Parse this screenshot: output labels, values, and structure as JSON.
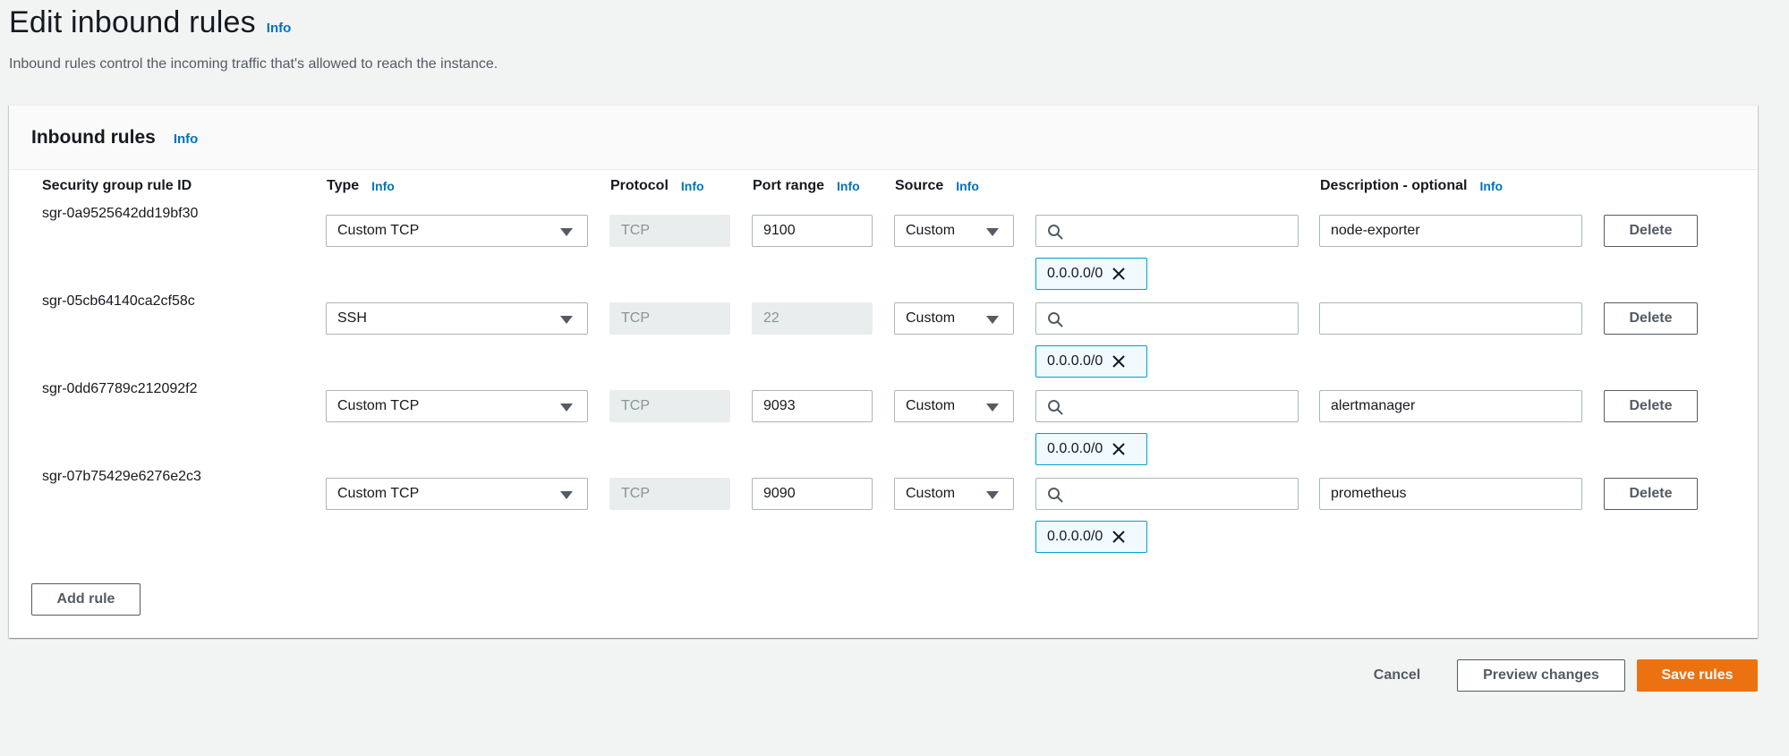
{
  "page": {
    "title": "Edit inbound rules",
    "info": "Info",
    "description": "Inbound rules control the incoming traffic that's allowed to reach the instance."
  },
  "panel": {
    "title": "Inbound rules",
    "info": "Info"
  },
  "columns": {
    "rule_id": "Security group rule ID",
    "type": "Type",
    "protocol": "Protocol",
    "port_range": "Port range",
    "source": "Source",
    "description": "Description - optional",
    "info": "Info"
  },
  "rules": [
    {
      "id": "sgr-0a9525642dd19bf30",
      "type": "Custom TCP",
      "protocol": "TCP",
      "port": "9100",
      "port_editable": true,
      "source": "Custom",
      "cidr": "0.0.0.0/0",
      "description": "node-exporter",
      "delete": "Delete"
    },
    {
      "id": "sgr-05cb64140ca2cf58c",
      "type": "SSH",
      "protocol": "TCP",
      "port": "22",
      "port_editable": false,
      "source": "Custom",
      "cidr": "0.0.0.0/0",
      "description": "",
      "delete": "Delete"
    },
    {
      "id": "sgr-0dd67789c212092f2",
      "type": "Custom TCP",
      "protocol": "TCP",
      "port": "9093",
      "port_editable": true,
      "source": "Custom",
      "cidr": "0.0.0.0/0",
      "description": "alertmanager",
      "delete": "Delete"
    },
    {
      "id": "sgr-07b75429e6276e2c3",
      "type": "Custom TCP",
      "protocol": "TCP",
      "port": "9090",
      "port_editable": true,
      "source": "Custom",
      "cidr": "0.0.0.0/0",
      "description": "prometheus",
      "delete": "Delete"
    }
  ],
  "actions": {
    "add_rule": "Add rule",
    "cancel": "Cancel",
    "preview": "Preview changes",
    "save": "Save rules"
  },
  "colors": {
    "accent": "#ec7211",
    "link": "#0073bb",
    "token_border": "#00a1c9"
  }
}
